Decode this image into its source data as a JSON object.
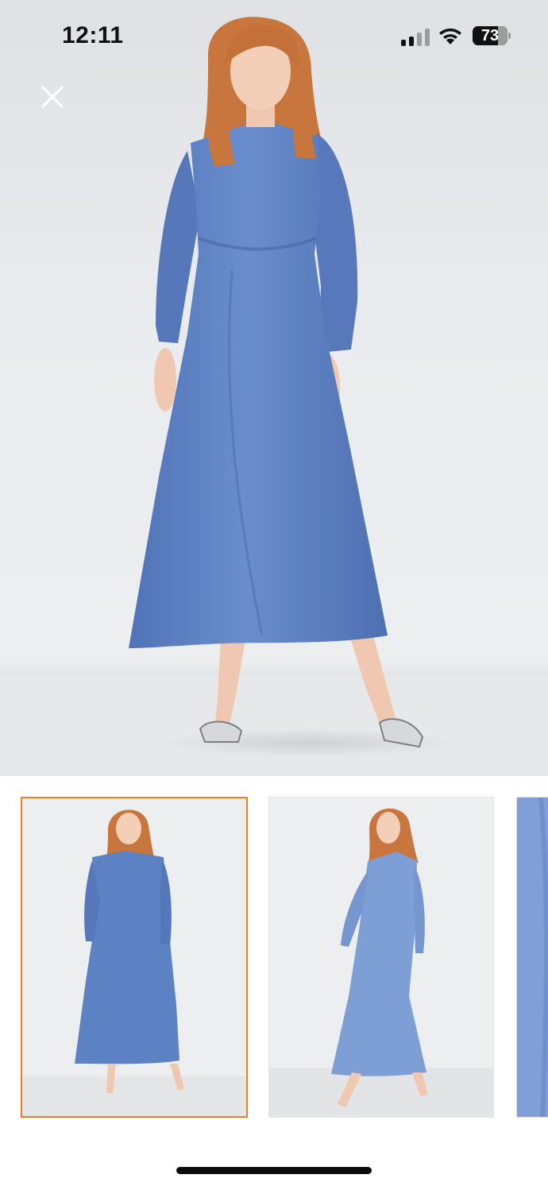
{
  "status_bar": {
    "time": "12:11",
    "battery_percent": "73",
    "battery_level": 0.73,
    "signal_bars_active": 2,
    "signal_bars_total": 4
  },
  "gallery": {
    "selected_index": 0,
    "thumbnail_count_visible": 3
  },
  "colors": {
    "accent": "#f27a1a",
    "dress": "#5d82c4"
  },
  "icons": {
    "close": "close-icon",
    "wifi": "wifi-icon",
    "signal": "cellular-signal-icon",
    "battery": "battery-icon"
  }
}
